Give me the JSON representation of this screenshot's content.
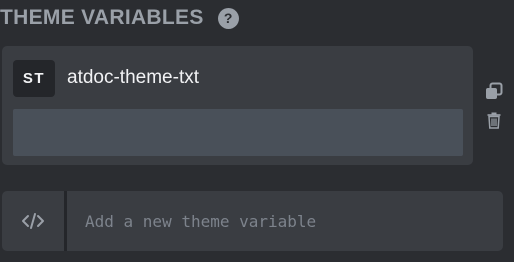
{
  "header": {
    "title": "THEME VARIABLES",
    "help_icon_label": "?"
  },
  "variables": [
    {
      "type_badge": "ST",
      "name": "atdoc-theme-txt",
      "value": ""
    }
  ],
  "actions": {
    "copy_icon": "copy-icon",
    "delete_icon": "trash-icon"
  },
  "new_variable": {
    "icon": "code-icon",
    "placeholder": "Add a new theme variable",
    "value": ""
  },
  "colors": {
    "background": "#2b2d31",
    "card": "#3a3d42",
    "value_field": "#495059",
    "badge_bg": "#24262a",
    "muted_text": "#9aa0a8",
    "placeholder_text": "#7d838c"
  }
}
